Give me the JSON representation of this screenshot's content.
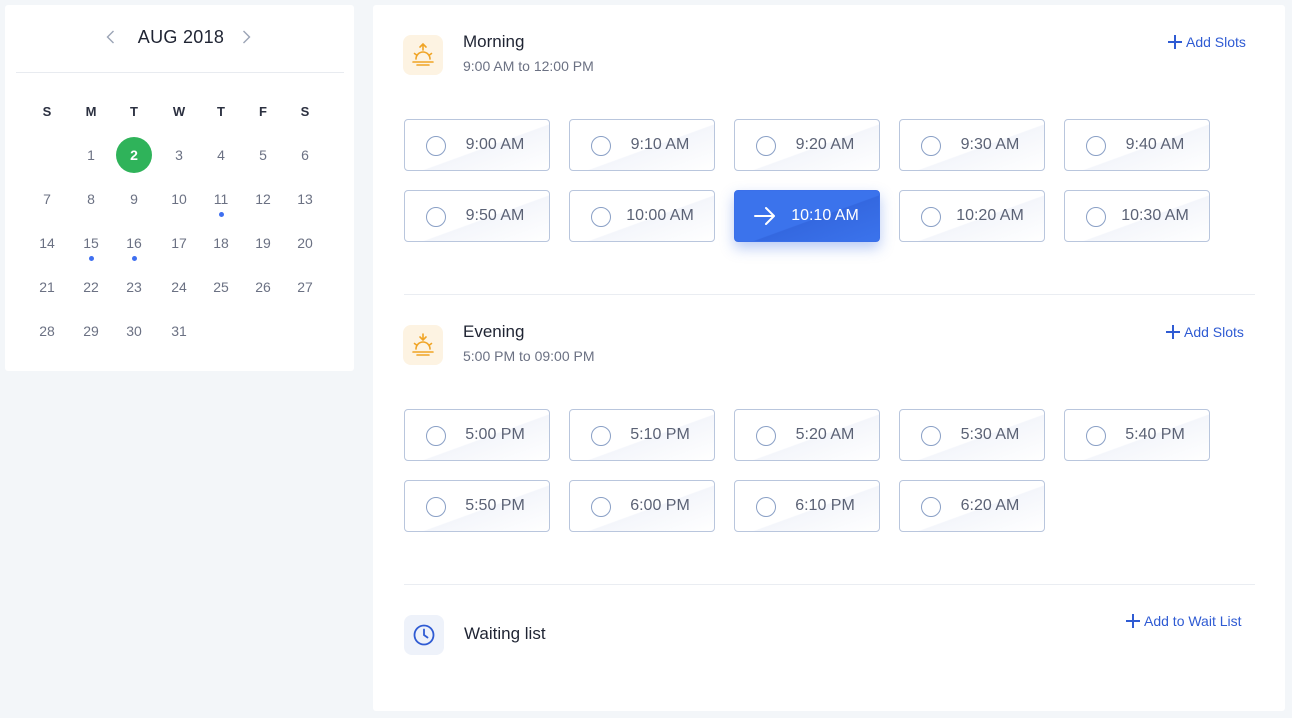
{
  "calendar": {
    "month_label": "AUG 2018",
    "weekdays": [
      "S",
      "M",
      "T",
      "W",
      "T",
      "F",
      "S"
    ],
    "weeks": [
      [
        "",
        "1",
        "2",
        "3",
        "4",
        "5",
        "6"
      ],
      [
        "7",
        "8",
        "9",
        "10",
        "11",
        "12",
        "13"
      ],
      [
        "14",
        "15",
        "16",
        "17",
        "18",
        "19",
        "20"
      ],
      [
        "21",
        "22",
        "23",
        "24",
        "25",
        "26",
        "27"
      ],
      [
        "28",
        "29",
        "30",
        "31",
        "",
        "",
        ""
      ]
    ],
    "selected_day": "2",
    "marked_days": [
      "11",
      "15",
      "16"
    ],
    "colors": {
      "selected": "#2fb35a",
      "marker": "#3f6ff0"
    }
  },
  "morning": {
    "title": "Morning",
    "range": "9:00 AM  to 12:00 PM",
    "add_label": "Add Slots",
    "icon": "sunrise-icon",
    "slots": [
      "9:00 AM",
      "9:10 AM",
      "9:20 AM",
      "9:30 AM",
      "9:40 AM",
      "9:50 AM",
      "10:00 AM",
      "10:10 AM",
      "10:20 AM",
      "10:30 AM"
    ],
    "selected_slot": "10:10 AM"
  },
  "evening": {
    "title": "Evening",
    "range": "5:00 PM  to 09:00 PM",
    "add_label": "Add Slots",
    "icon": "sunset-icon",
    "slots": [
      "5:00 PM",
      "5:10 PM",
      "5:20 AM",
      "5:30 AM",
      "5:40 PM",
      "5:50 PM",
      "6:00 PM",
      "6:10 PM",
      "6:20 AM"
    ]
  },
  "waiting": {
    "title": "Waiting list",
    "add_label": "Add to Wait List",
    "icon": "clock-icon"
  },
  "colors": {
    "accent": "#3b73ec",
    "link": "#2f5bd3",
    "sun_icon": "#f0a425"
  }
}
